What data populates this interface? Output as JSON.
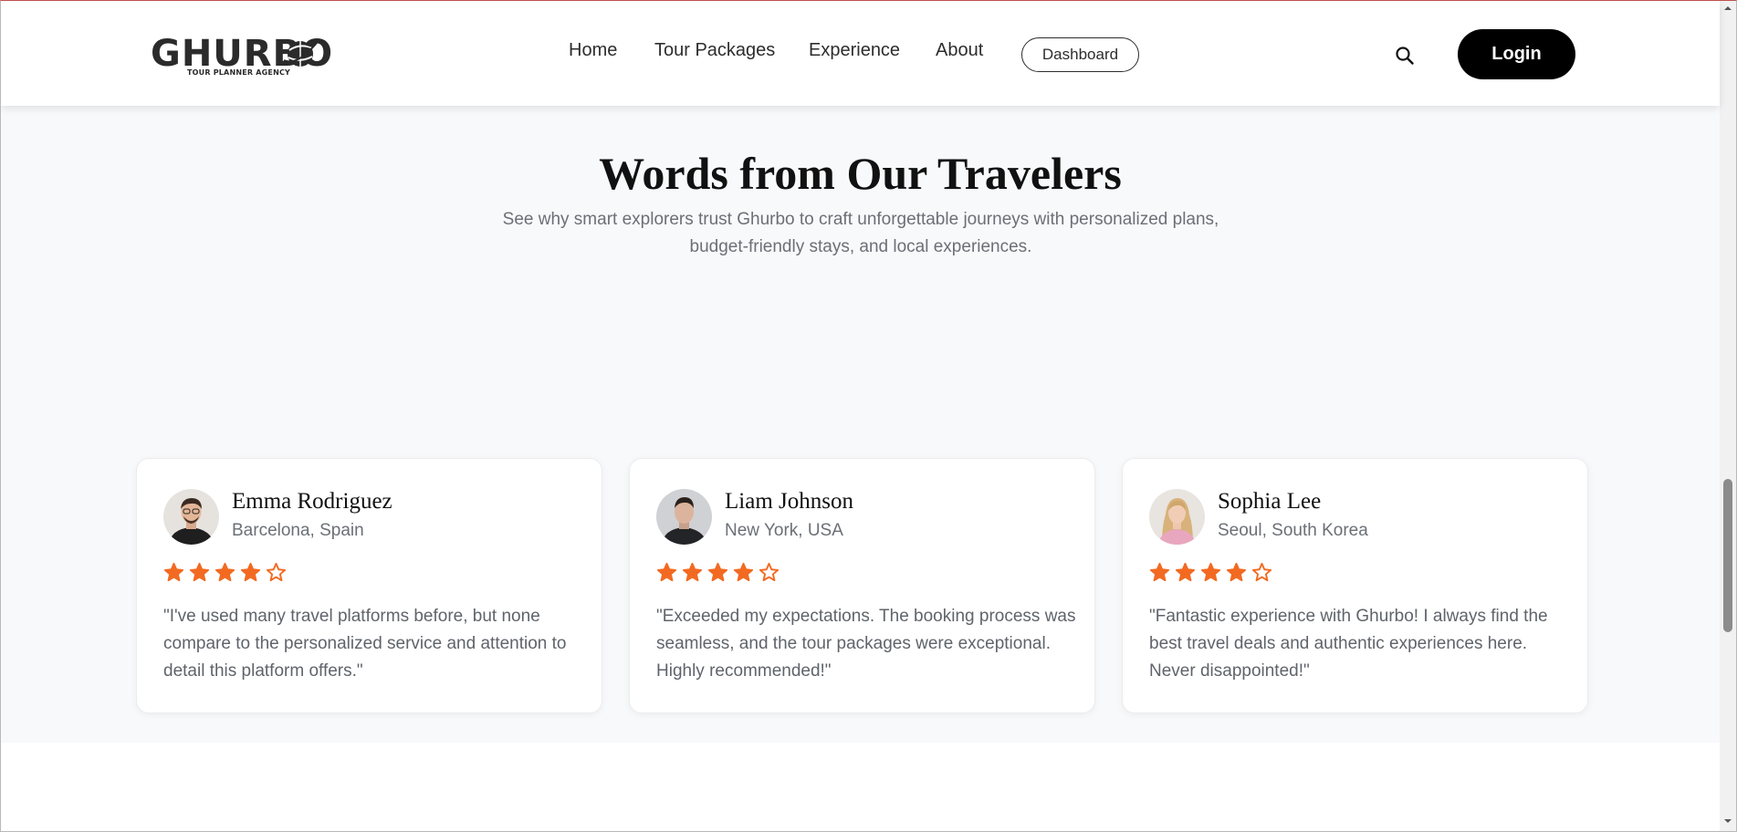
{
  "brand": {
    "name": "GHURBO",
    "tagline": "TOUR PLANNER AGENCY"
  },
  "nav": {
    "links": [
      "Home",
      "Tour Packages",
      "Experience",
      "About"
    ],
    "dashboard_label": "Dashboard",
    "login_label": "Login",
    "search_icon": "search-icon"
  },
  "testimonials": {
    "title": "Words from Our Travelers",
    "subtitle": "See why smart explorers trust Ghurbo to craft unforgettable journeys with personalized plans, budget-friendly stays, and local experiences.",
    "cards": [
      {
        "name": "Emma Rodriguez",
        "location": "Barcelona, Spain",
        "rating": 4,
        "max_rating": 5,
        "quote": "\"I've used many travel platforms before, but none compare to the personalized service and attention to detail this platform offers.\""
      },
      {
        "name": "Liam Johnson",
        "location": "New York, USA",
        "rating": 4,
        "max_rating": 5,
        "quote": "\"Exceeded my expectations. The booking process was seamless, and the tour packages were exceptional. Highly recommended!\""
      },
      {
        "name": "Sophia Lee",
        "location": "Seoul, South Korea",
        "rating": 4,
        "max_rating": 5,
        "quote": "\"Fantastic experience with Ghurbo! I always find the best travel deals and authentic experiences here. Never disappointed!\""
      }
    ]
  },
  "colors": {
    "star": "#f26a21",
    "login_bg": "#000000",
    "section_bg": "#f8f9fb",
    "text_muted": "#6b6f76"
  }
}
